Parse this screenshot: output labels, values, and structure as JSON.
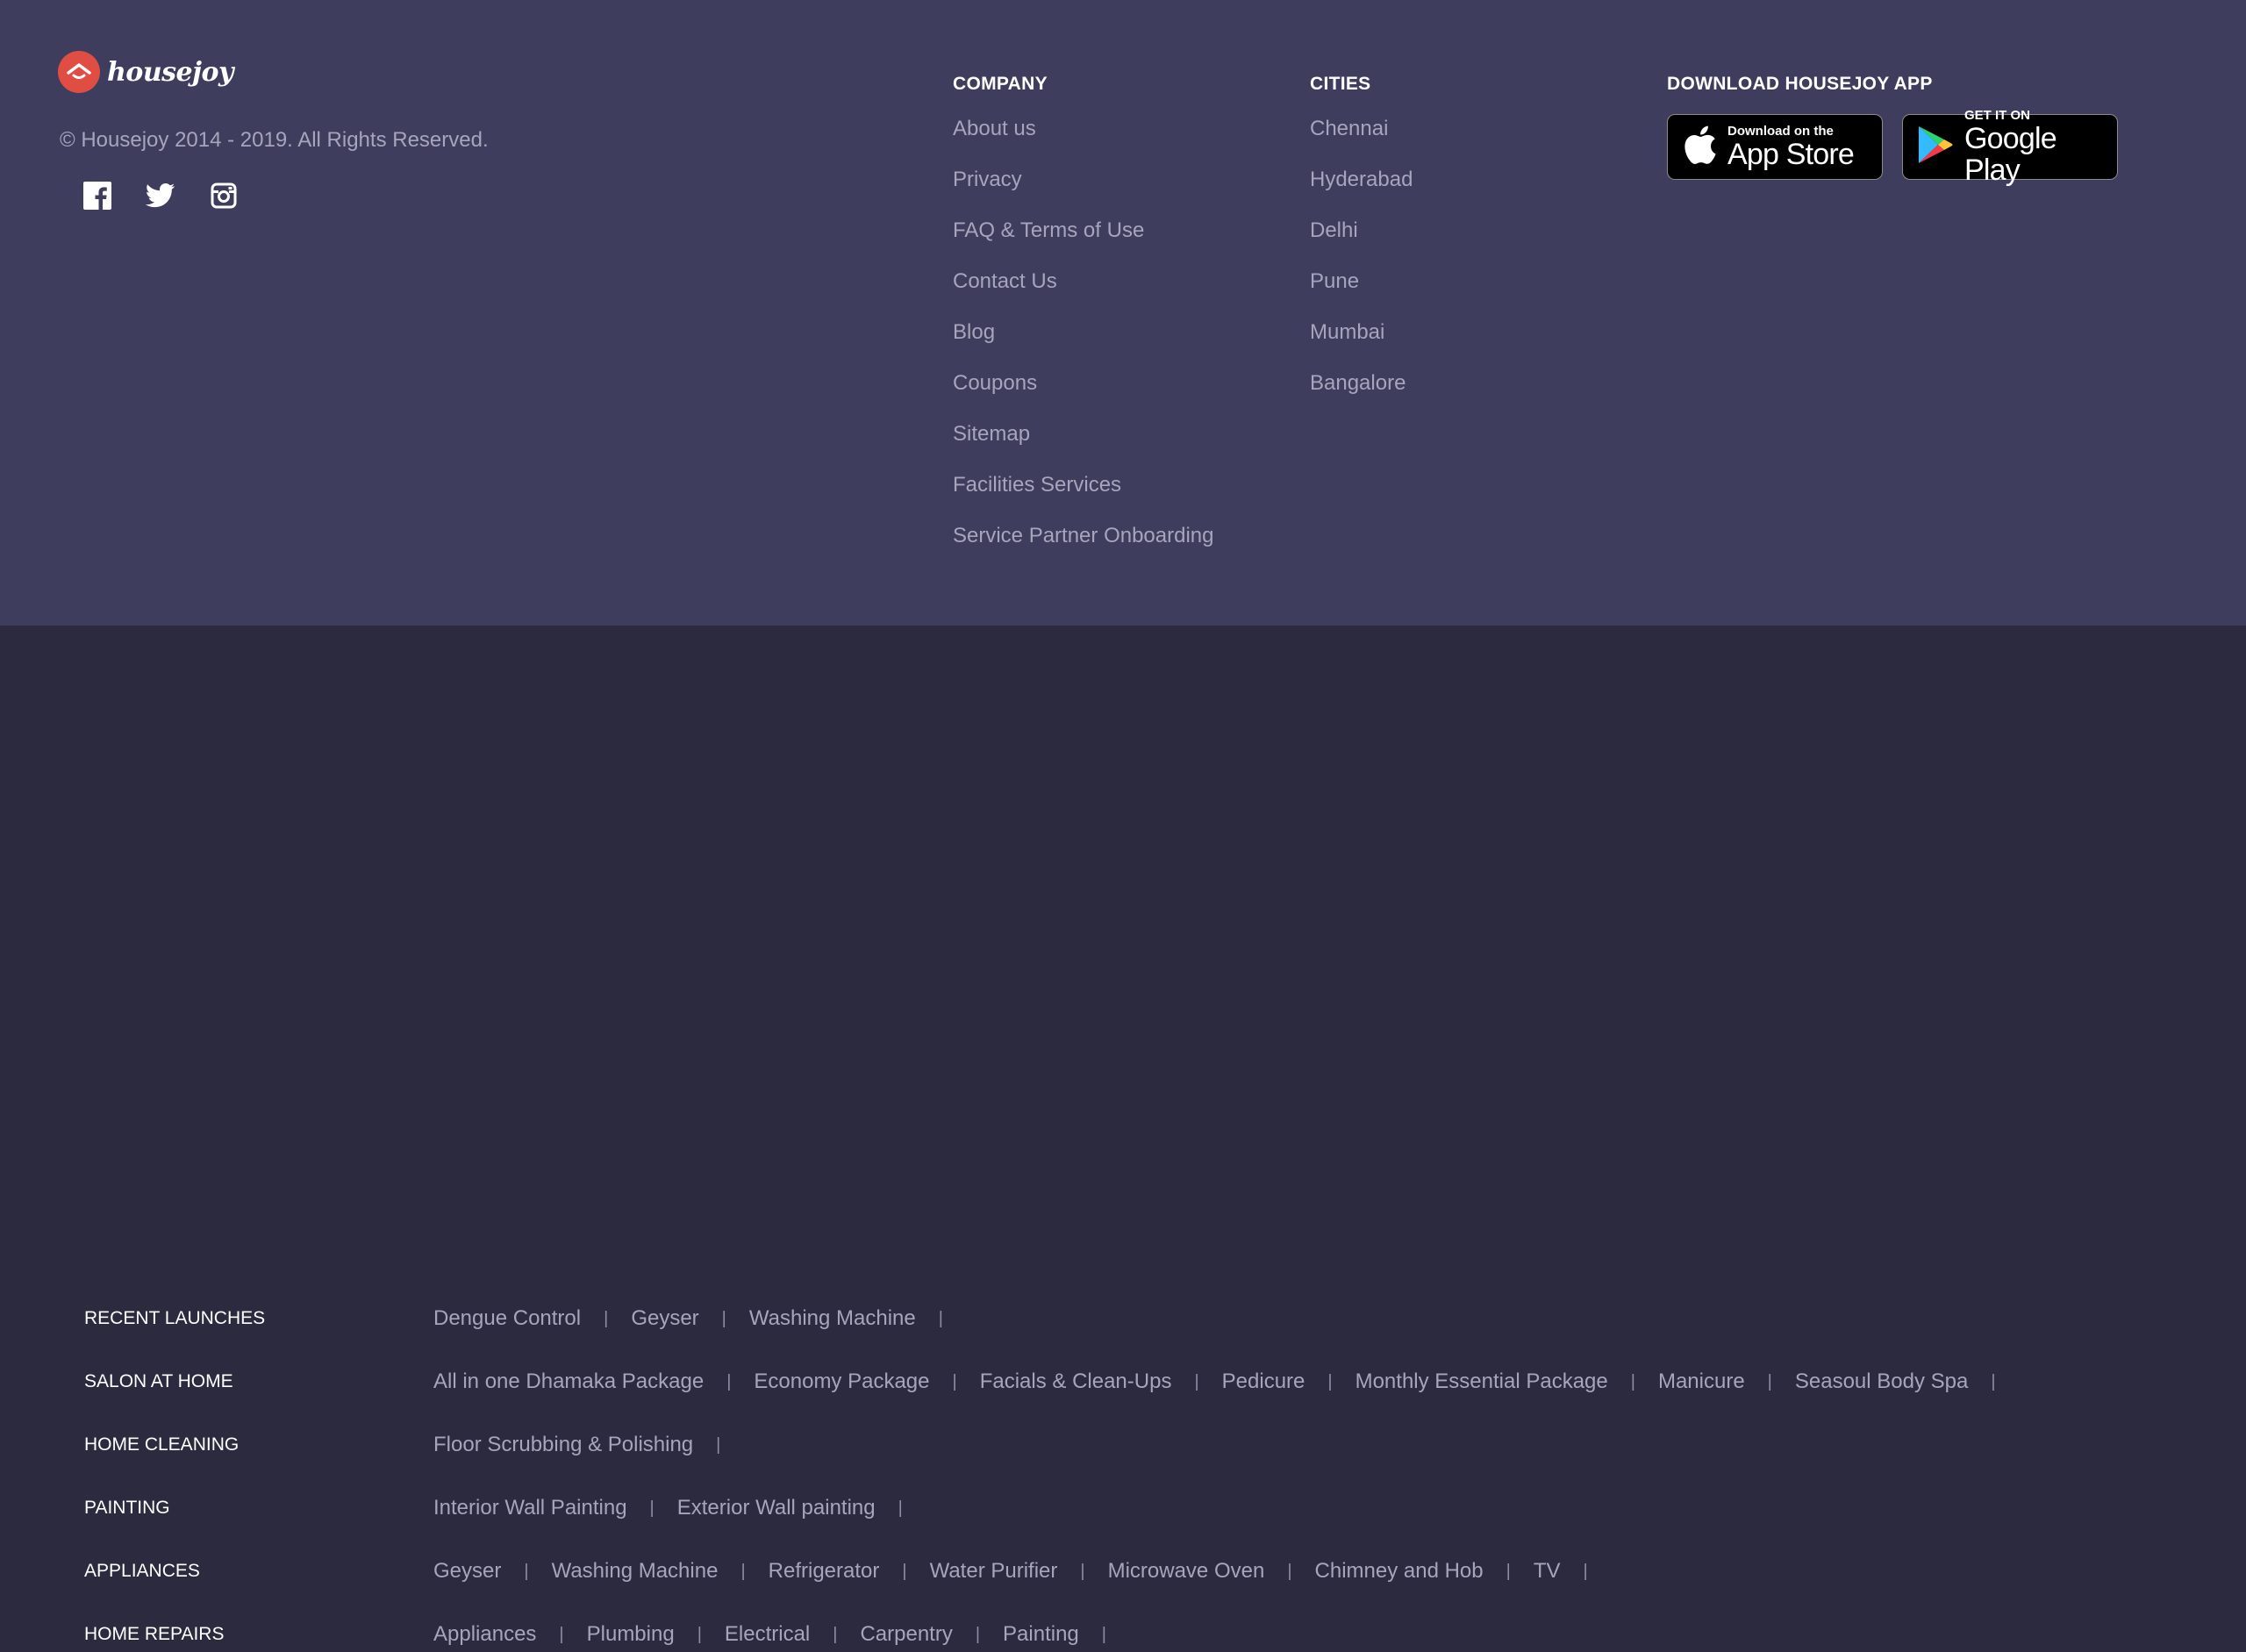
{
  "brand": {
    "name": "housejoy",
    "copyright": "© Housejoy 2014 - 2019. All Rights Reserved."
  },
  "social": [
    "facebook-icon",
    "twitter-icon",
    "instagram-icon"
  ],
  "company": {
    "heading": "COMPANY",
    "links": [
      "About us",
      "Privacy",
      "FAQ & Terms of Use",
      "Contact Us",
      "Blog",
      "Coupons",
      "Sitemap",
      "Facilities Services",
      "Service Partner Onboarding"
    ]
  },
  "cities": {
    "heading": "CITIES",
    "links": [
      "Chennai",
      "Hyderabad",
      "Delhi",
      "Pune",
      "Mumbai",
      "Bangalore"
    ]
  },
  "app": {
    "heading": "DOWNLOAD HOUSEJOY APP",
    "appstore_small": "Download on the",
    "appstore_big": "App Store",
    "play_small": "GET IT ON",
    "play_big": "Google Play"
  },
  "services": [
    {
      "category": "RECENT LAUNCHES",
      "items": [
        "Dengue Control",
        "Geyser",
        "Washing Machine"
      ]
    },
    {
      "category": "SALON AT HOME",
      "items": [
        "All in one Dhamaka Package",
        "Economy Package",
        "Facials & Clean-Ups",
        "Pedicure",
        "Monthly Essential Package",
        "Manicure",
        "Seasoul Body Spa"
      ]
    },
    {
      "category": "HOME CLEANING",
      "items": [
        "Floor Scrubbing & Polishing"
      ]
    },
    {
      "category": "PAINTING",
      "items": [
        "Interior Wall Painting",
        "Exterior Wall painting"
      ]
    },
    {
      "category": "APPLIANCES",
      "items": [
        "Geyser",
        "Washing Machine",
        "Refrigerator",
        "Water Purifier",
        "Microwave Oven",
        "Chimney and Hob",
        "TV"
      ]
    },
    {
      "category": "HOME REPAIRS",
      "items": [
        "Appliances",
        "Plumbing",
        "Electrical",
        "Carpentry",
        "Painting"
      ]
    }
  ],
  "colors": {
    "top_bg": "#3e3d5e",
    "bottom_bg": "#2b2a3e",
    "link": "#a6a5bb",
    "logo_red": "#e04e43"
  }
}
